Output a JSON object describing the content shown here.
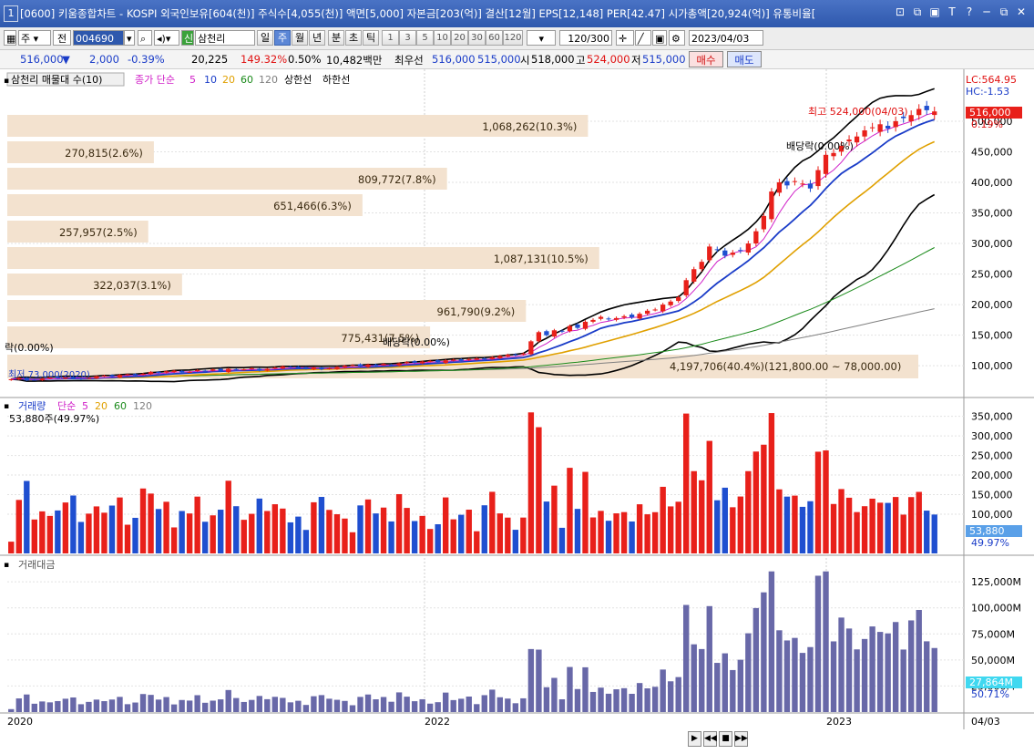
{
  "window": {
    "number": "1",
    "title": "[0600] 키움종합차트 - KOSPI 외국인보유[604(천)] 주식수[4,055(천)] 액면[5,000] 자본금[203(억)] 결산[12월] EPS[12,148] PER[42.47] 시가총액[20,924(억)] 유통비율[",
    "controls": [
      "⊡",
      "⧉",
      "▣",
      "T",
      "?",
      "─",
      "⧉",
      "✕"
    ]
  },
  "toolbar": {
    "market": "주",
    "prev": "전",
    "code": "004690",
    "name_badge": "신",
    "name": "삼천리",
    "periods": [
      "일",
      "주",
      "월",
      "년",
      "분",
      "초",
      "틱"
    ],
    "active_period": "주",
    "intervals": [
      "1",
      "3",
      "5",
      "10",
      "20",
      "30",
      "60",
      "120"
    ],
    "count": "120/300",
    "date": "2023/04/03"
  },
  "quote": {
    "price": "516,000",
    "arrow": "▼",
    "change": "2,000",
    "change_pct": "-0.39%",
    "volume": "20,225",
    "vol_ratio": "149.32%",
    "turnover": "0.50%",
    "amount": "10,482백만",
    "best_label": "최우선",
    "ask": "516,000",
    "bid": "515,000",
    "open_label": "시",
    "open": "518,000",
    "high_label": "고",
    "high": "524,000",
    "low_label": "저",
    "low": "515,000",
    "buy": "매수",
    "sell": "매도"
  },
  "price_panel": {
    "legend_title": "삼천리 매물대 수(10)",
    "legend_items": [
      {
        "text": "종가 단순",
        "color": "#d020c8"
      },
      {
        "text": "5",
        "color": "#d020c8"
      },
      {
        "text": "10",
        "color": "#1a3cc8"
      },
      {
        "text": "20",
        "color": "#e0a000"
      },
      {
        "text": "60",
        "color": "#1a8a1a"
      },
      {
        "text": "120",
        "color": "#808080"
      },
      {
        "text": "상한선",
        "color": "#000000"
      },
      {
        "text": "하한선",
        "color": "#000000"
      }
    ],
    "lc": "LC:564.95",
    "hc": "HC:-1.53",
    "current_price": "516,000",
    "current_pct": "0.19%",
    "max_label": "최고 524,000(04/03)",
    "dividend_label": "배당락(0.00%)",
    "dividend_label_mid": "배당락(0.00%)",
    "dividend_label_left": "락(0.00%)",
    "low_label": "최저 73,000(2020)",
    "y_ticks": [
      "100,000",
      "150,000",
      "200,000",
      "250,000",
      "300,000",
      "350,000",
      "400,000",
      "450,000",
      "500,000"
    ],
    "profile": [
      {
        "label": "1,068,262(10.3%)",
        "width_pct": 10.3
      },
      {
        "label": "270,815(2.6%)",
        "width_pct": 2.6
      },
      {
        "label": "809,772(7.8%)",
        "width_pct": 7.8
      },
      {
        "label": "651,466(6.3%)",
        "width_pct": 6.3
      },
      {
        "label": "257,957(2.5%)",
        "width_pct": 2.5
      },
      {
        "label": "1,087,131(10.5%)",
        "width_pct": 10.5
      },
      {
        "label": "322,037(3.1%)",
        "width_pct": 3.1
      },
      {
        "label": "961,790(9.2%)",
        "width_pct": 9.2
      },
      {
        "label": "775,431(7.5%)",
        "width_pct": 7.5
      },
      {
        "label": "4,197,706(40.4%)(121,800.00 ~ 78,000.00)",
        "width_pct": 40.4
      }
    ]
  },
  "volume_panel": {
    "legend": "거래량",
    "ma_label": "단순",
    "ma_items": [
      {
        "text": "5",
        "color": "#d020c8"
      },
      {
        "text": "20",
        "color": "#e0a000"
      },
      {
        "text": "60",
        "color": "#1a8a1a"
      },
      {
        "text": "120",
        "color": "#808080"
      }
    ],
    "last": "53,880주(49.97%)",
    "y_ticks": [
      "100,000",
      "150,000",
      "200,000",
      "250,000",
      "300,000",
      "350,000"
    ],
    "current": "53,880",
    "current_pct": "49.97%"
  },
  "amount_panel": {
    "legend": "거래대금",
    "y_ticks": [
      "25,000M",
      "50,000M",
      "75,000M",
      "100,000M",
      "125,000M"
    ],
    "current": "27,864M",
    "current_pct": "50.71%"
  },
  "x_axis": [
    "2020",
    "2022",
    "2023",
    "04/03"
  ],
  "colors": {
    "up": "#e8201a",
    "down": "#1f4fd0",
    "ma5": "#d020c8",
    "ma10": "#1a3cc8",
    "ma20": "#e0a000",
    "ma60": "#1a8a1a",
    "ma120": "#808080",
    "band": "#000000",
    "profile": "#f3e2cf",
    "amount": "#6868a8"
  },
  "chart_data": {
    "type": "candlestick",
    "close": [
      78000,
      80000,
      76000,
      77000,
      79000,
      81000,
      80000,
      82000,
      79000,
      78000,
      80000,
      83000,
      84000,
      82000,
      85000,
      86000,
      84000,
      87000,
      90000,
      88000,
      91000,
      92000,
      89000,
      90000,
      93000,
      92000,
      94000,
      91000,
      95000,
      93000,
      94000,
      96000,
      92000,
      95000,
      97000,
      99000,
      98000,
      96000,
      95000,
      97000,
      94000,
      96000,
      98000,
      100000,
      101000,
      99000,
      102000,
      100000,
      103000,
      101000,
      104000,
      106000,
      105000,
      107000,
      108000,
      106000,
      109000,
      110000,
      108000,
      111000,
      112000,
      110000,
      114000,
      116000,
      118000,
      117000,
      120000,
      140000,
      155000,
      150000,
      158000,
      156000,
      165000,
      162000,
      172000,
      175000,
      180000,
      176000,
      178000,
      181000,
      179000,
      185000,
      190000,
      192000,
      200000,
      205000,
      212000,
      240000,
      258000,
      270000,
      295000,
      290000,
      280000,
      285000,
      288000,
      300000,
      320000,
      345000,
      385000,
      400000,
      395000,
      402000,
      398000,
      390000,
      420000,
      445000,
      448000,
      460000,
      470000,
      475000,
      485000,
      490000,
      495000,
      488000,
      500000,
      505000,
      510000,
      520000,
      518000,
      516000
    ]
  }
}
